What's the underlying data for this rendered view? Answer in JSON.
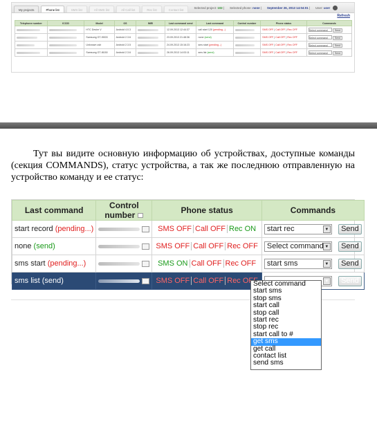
{
  "top": {
    "tabs": [
      "My projects",
      "Phone list",
      "SMS list",
      "All SMS list",
      "All Call list",
      "Rec list",
      "Contact list"
    ],
    "selected_project_label": "Selected project:",
    "selected_project": "102",
    "selected_phone_label": "Selected phone:",
    "selected_phone": "none",
    "datetime": "September 26, 2013 14:04:01",
    "user_label": "User:",
    "user": "user",
    "refresh": "Refresh",
    "headers": [
      "Telephone number",
      "ICCID",
      "Model",
      "OS",
      "IMEI",
      "Last command send",
      "Last command",
      "Control number",
      "Phone status",
      "Commands"
    ],
    "rows": [
      {
        "model": "HTC Desire V",
        "os": "Android 4.0.3",
        "date": "12.09.2013 12:44:37",
        "cmd": "call start 120",
        "cmd_state": "(pending...)",
        "s1": "SMS OFF",
        "s2": "Call OFF",
        "s3": "Rec OFF",
        "select": "Select command",
        "send": "Send"
      },
      {
        "model": "Samsung GT-I9003",
        "os": "Android 2.3.6",
        "date": "23.09.2013 21:48:36",
        "cmd": "none",
        "cmd_state": "(send)",
        "s1": "SMS OFF",
        "s2": "Call OFF",
        "s3": "Rec OFF",
        "select": "Select command",
        "send": "Send"
      },
      {
        "model": "Unknown usb",
        "os": "Android 2.3.5",
        "date": "24.09.2013 15:16:23",
        "cmd": "sms start",
        "cmd_state": "(pending...)",
        "s1": "SMS OFF",
        "s2": "Call OFF",
        "s3": "Rec OFF",
        "select": "Select command",
        "send": "Send"
      },
      {
        "model": "Samsung GT-I8150",
        "os": "Android 2.3.6",
        "date": "26.09.2013 14:03:11",
        "cmd": "sms list",
        "cmd_state": "(send)",
        "s1": "SMS OFF",
        "s2": "Call OFF",
        "s3": "Rec OFF",
        "select": "Select command",
        "send": "Send"
      }
    ]
  },
  "paragraph": "Тут вы видите основную информацию об устройствах, доступные команды (секция COMMANDS), статус устройства, а так же последнюю отправленную на устройство команду и ее статус:",
  "big": {
    "headers": [
      "Last command",
      "Control number",
      "Phone status",
      "Commands"
    ],
    "rows": [
      {
        "cmd": "start record",
        "state": "(pending...)",
        "s1": "SMS OFF",
        "s2": "Call OFF",
        "s3": "Rec ON",
        "select": "start rec",
        "send": "Send"
      },
      {
        "cmd": "none",
        "state": "(send)",
        "s1": "SMS OFF",
        "s2": "Call OFF",
        "s3": "Rec OFF",
        "select": "Select command",
        "send": "Send"
      },
      {
        "cmd": "sms start",
        "state": "(pending...)",
        "s1": "SMS ON",
        "s2": "Call OFF",
        "s3": "Rec OFF",
        "select": "start sms",
        "send": "Send"
      },
      {
        "cmd": "sms list",
        "state": "(send)",
        "s1": "SMS OFF",
        "s2": "Call OFF",
        "s3": "Rec OFF",
        "select": "Select command",
        "send": "Send"
      }
    ],
    "options": [
      "Select command",
      "start sms",
      "stop sms",
      "start call",
      "stop call",
      "start rec",
      "stop rec",
      "start call to #",
      "get sms",
      "get call",
      "contact list",
      "send sms"
    ],
    "highlighted_option": "get sms"
  },
  "colors": {
    "header_green": "#d4e8c4",
    "off_red": "#e02020",
    "on_green": "#1a9a1a",
    "selected_row": "#2b4a75",
    "highlight": "#3399ff"
  }
}
